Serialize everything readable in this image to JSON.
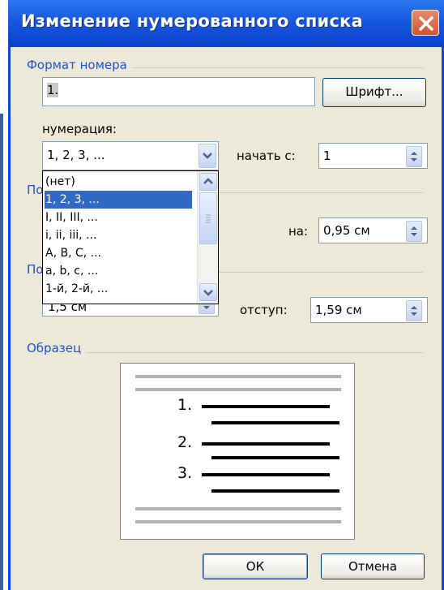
{
  "dialog": {
    "title": "Изменение нумерованного списка",
    "number_format_group": "Формат номера",
    "number_format_value": "1.",
    "font_button": "Шрифт...",
    "numbering_label": "нумерация:",
    "numbering_selected": "1, 2, 3, ...",
    "start_at_label": "начать с:",
    "start_at_value": "1",
    "on_label": "на:",
    "on_value": "0,95 см",
    "indent_label": "отступ:",
    "indent_value": "1,59 см",
    "hidden_value": "1,5 см",
    "hidden_group_partial_1": "По",
    "hidden_group_partial_2": "По",
    "sample_group": "Образец",
    "ok_button": "ОК",
    "cancel_button": "Отмена"
  },
  "numbering_options": [
    "(нет)",
    "1, 2, 3, ...",
    "I, II, III, ...",
    "i, ii, iii, ...",
    "A, B, C, ...",
    "a, b, c, ...",
    "1-й, 2-й, ..."
  ],
  "selected_index": 1,
  "preview_numbers": [
    "1.",
    "2.",
    "3."
  ],
  "colors": {
    "title_blue": "#0a43c8",
    "group_label_blue": "#1f4fd6",
    "selection": "#316ac5",
    "close_red": "#d2542f",
    "dialog_face": "#ece9d8"
  }
}
